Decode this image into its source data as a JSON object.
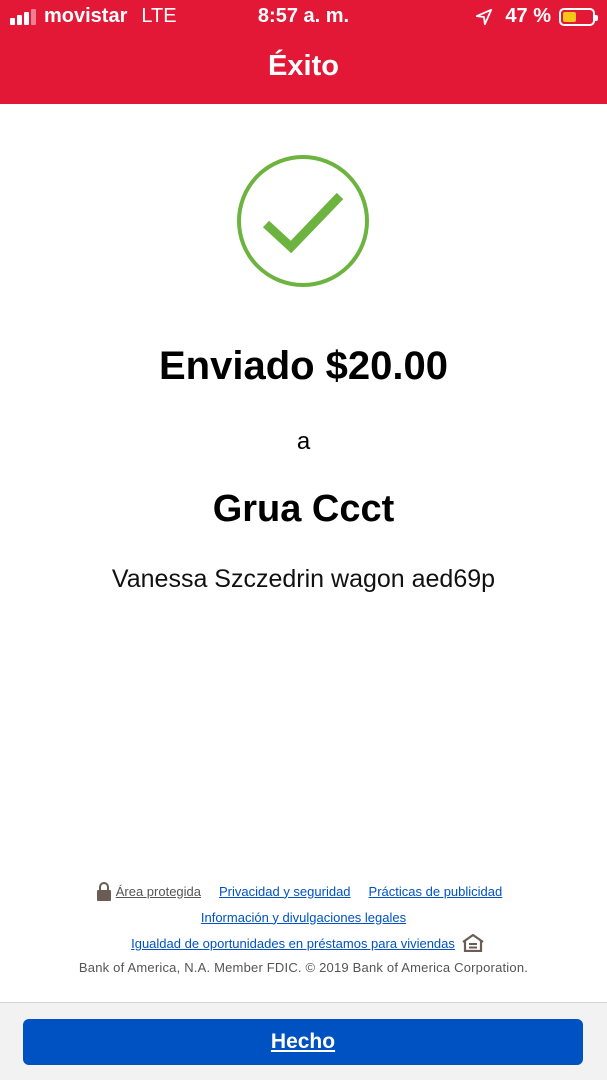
{
  "status_bar": {
    "carrier": "movistar",
    "network": "LTE",
    "time": "8:57 a. m.",
    "battery_percent_text": "47 %",
    "battery_level": 0.47,
    "battery_color": "#f5c518",
    "signal_bars": 4,
    "signal_active": 3
  },
  "header": {
    "title": "Éxito",
    "background_color": "#e31837"
  },
  "success": {
    "icon": "checkmark-circle-icon",
    "icon_color": "#6db33f",
    "amount_text": "Enviado $20.00",
    "to_word": "a",
    "recipient_name": "Grua Ccct",
    "recipient_detail": "Vanessa Szczedrin wagon aed69p"
  },
  "footer": {
    "secure_area": "Área protegida",
    "privacy": "Privacidad y seguridad",
    "advertising": "Prácticas de publicidad",
    "legal_info": "Información y divulgaciones legales",
    "equal_housing": "Igualdad de oportunidades en préstamos para viviendas",
    "legal_text": "Bank of America, N.A. Member FDIC. © 2019 Bank of America Corporation.",
    "link_color": "#0052c2"
  },
  "actions": {
    "done_label": "Hecho",
    "button_color": "#0052c2"
  }
}
